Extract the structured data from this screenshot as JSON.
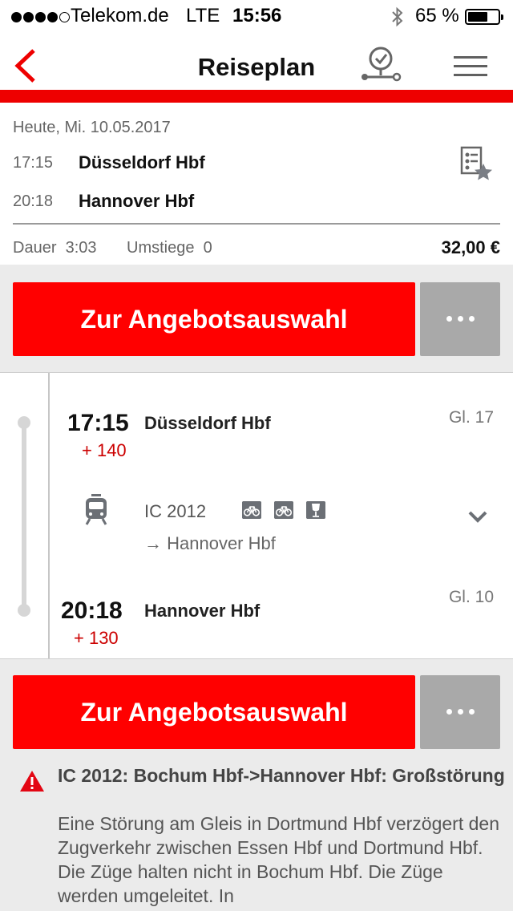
{
  "status_bar": {
    "carrier": "Telekom.de",
    "network": "LTE",
    "time": "15:56",
    "battery": "65 %"
  },
  "nav": {
    "title": "Reiseplan",
    "back_icon": "chevron-left-icon",
    "timeline_icon": "realtime-clock-icon",
    "menu_icon": "hamburger-menu-icon"
  },
  "summary": {
    "date": "Heute, Mi. 10.05.2017",
    "departure_time": "17:15",
    "departure_station": "Düsseldorf Hbf",
    "arrival_time": "20:18",
    "arrival_station": "Hannover Hbf",
    "duration_label": "Dauer",
    "duration": "3:03",
    "changes_label": "Umstiege",
    "changes": "0",
    "price": "32,00 €"
  },
  "cta": {
    "label": "Zur Angebotsauswahl",
    "more_label": "•••"
  },
  "journey": {
    "departure": {
      "time": "17:15",
      "delay": "+ 140",
      "station": "Düsseldorf Hbf",
      "platform": "Gl. 17"
    },
    "train": {
      "name": "IC 2012",
      "direction": "→ Hannover Hbf",
      "amenities": [
        "bicycle-icon",
        "bicycle-icon",
        "bistro-icon"
      ]
    },
    "arrival": {
      "time": "20:18",
      "delay": "+ 130",
      "station": "Hannover Hbf",
      "platform": "Gl. 10"
    }
  },
  "alert": {
    "title": "IC  2012: Bochum Hbf->Hannover Hbf: Großstörung",
    "body": "Eine Störung am Gleis in Dortmund Hbf verzögert den Zugverkehr zwischen Essen Hbf und Dortmund Hbf. Die Züge halten nicht in Bochum Hbf. Die Züge werden umgeleitet. In",
    "color": "#e30613"
  },
  "colors": {
    "brand_red": "#ff0000",
    "delay_red": "#cc0000",
    "more_grey": "#a9a9a9"
  }
}
